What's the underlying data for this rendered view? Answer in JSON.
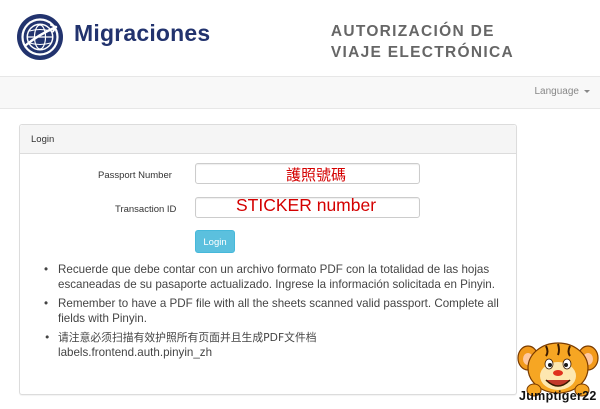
{
  "header": {
    "brand": "Migraciones",
    "title_line1": "AUTORIZACIÓN DE",
    "title_line2": "VIAJE ELECTRÓNICA"
  },
  "nav": {
    "language_label": "Language"
  },
  "login": {
    "panel_title": "Login",
    "passport_label": "Passport Number",
    "transaction_label": "Transaction ID",
    "passport_annotation": "護照號碼",
    "transaction_annotation": "STICKER number",
    "submit_label": "Login"
  },
  "notes": [
    "Recuerde que debe contar con un archivo formato PDF con la totalidad de las hojas escaneadas de su pasaporte actualizado. Ingrese la información solicitada en Pinyin.",
    "Remember to have a PDF file with all the sheets scanned valid passport. Complete all fields with Pinyin.",
    "请注意必须扫描有效护照所有页面并且生成PDF文件档",
    "labels.frontend.auth.pinyin_zh"
  ],
  "watermark": {
    "text": "Jumptiger22"
  },
  "colors": {
    "brand": "#22336e",
    "header_title": "#666666",
    "button": "#5bc0de",
    "annotation": "#d40000"
  },
  "icons": {
    "logo": "globe-logo-icon",
    "language_caret": "caret-down-icon",
    "sticker": "tigger-sticker-icon"
  }
}
